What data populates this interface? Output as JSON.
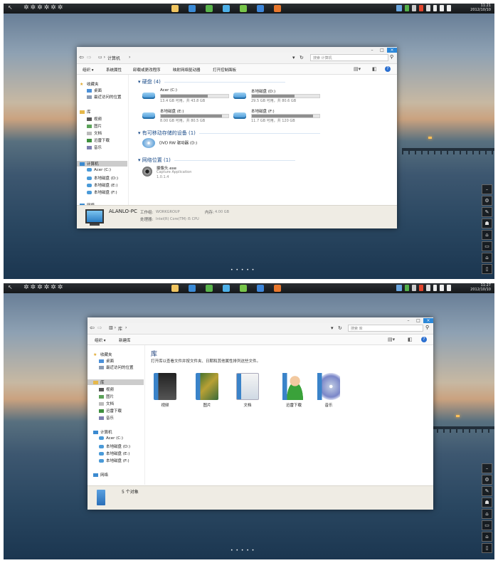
{
  "desktop": {
    "screens": [
      {
        "clock_time": "11:21",
        "clock_date": "2012/10/10"
      },
      {
        "clock_time": "11:27",
        "clock_date": "2012/10/10"
      }
    ],
    "dock_items": [
      "minimize-icon",
      "gear-icon",
      "brush-icon",
      "lock-icon",
      "home-icon",
      "monitor-icon",
      "house-icon",
      "trash-icon"
    ],
    "page_dots": "• • • • •",
    "colors": {
      "taskbar": "#1c1f22",
      "close_button": "#2b87d8",
      "accent_text": "#1c4d8a"
    }
  },
  "explorer_computer": {
    "breadcrumb": "计算机",
    "search_placeholder": "搜索 计算机",
    "commands": [
      "组织 ▾",
      "系统属性",
      "卸载或更改程序",
      "映射网络驱动器",
      "打开控制面板"
    ],
    "sidebar": {
      "favorites": {
        "header": "收藏夹",
        "items": [
          "桌面",
          "最近访问的位置"
        ]
      },
      "libraries": {
        "header": "库",
        "items": [
          "视频",
          "图片",
          "文档",
          "迅雷下载",
          "音乐"
        ]
      },
      "computer": {
        "header": "计算机",
        "items": [
          "Acer (C:)",
          "本地磁盘 (D:)",
          "本地磁盘 (E:)",
          "本地磁盘 (F:)"
        ]
      },
      "network": {
        "header": "网络"
      }
    },
    "groups": {
      "hard_disks": "硬盘 (4)",
      "removable": "有可移动存储的设备 (1)",
      "network": "网络位置 (1)"
    },
    "drives": [
      {
        "name": "Acer (C:)",
        "free": "13.4 GB 可用，共 43.8 GB",
        "used_fraction": 0.69
      },
      {
        "name": "本地磁盘 (D:)",
        "free": "29.5 GB 可用，共 80.6 GB",
        "used_fraction": 0.63
      },
      {
        "name": "本地磁盘 (E:)",
        "free": "8.00 GB 可用，共 80.5 GB",
        "used_fraction": 0.9
      },
      {
        "name": "本地磁盘 (F:)",
        "free": "11.7 GB 可用，共 120 GB",
        "used_fraction": 0.9
      }
    ],
    "dvd": "DVD RW 驱动器 (D:)",
    "network_item": {
      "name": "摄像头.exe",
      "line2": "Capture Application",
      "line3": "1.0.1.4"
    },
    "details": {
      "pc_name": "ALANLO-PC",
      "workgroup_label": "工作组:",
      "workgroup_value": "WORKGROUP",
      "memory_label": "内存:",
      "memory_value": "4.00 GB",
      "processor_label": "处理器:",
      "processor_value": "Intel(R) Core(TM) i5 CPU"
    }
  },
  "explorer_library": {
    "breadcrumb": "库",
    "search_placeholder": "搜索 库",
    "commands": [
      "组织 ▾",
      "新建库"
    ],
    "sidebar": {
      "favorites": {
        "header": "收藏夹",
        "items": [
          "桌面",
          "最近访问的位置"
        ]
      },
      "libraries": {
        "header": "库",
        "items": [
          "视频",
          "图片",
          "文档",
          "迅雷下载",
          "音乐"
        ]
      },
      "computer": {
        "header": "计算机",
        "items": [
          "Acer (C:)",
          "本地磁盘 (D:)",
          "本地磁盘 (E:)",
          "本地磁盘 (F:)"
        ]
      },
      "network": {
        "header": "网络"
      }
    },
    "title": "库",
    "description": "打开库以查看文件并按文件夹、日期和其他属性排列这些文件。",
    "libraries": [
      {
        "label": "视频",
        "icon": "video-library-icon"
      },
      {
        "label": "图片",
        "icon": "picture-library-icon"
      },
      {
        "label": "文档",
        "icon": "document-library-icon"
      },
      {
        "label": "迅雷下载",
        "icon": "download-library-icon"
      },
      {
        "label": "音乐",
        "icon": "music-library-icon"
      }
    ],
    "details": {
      "count": "5 个对象"
    }
  }
}
